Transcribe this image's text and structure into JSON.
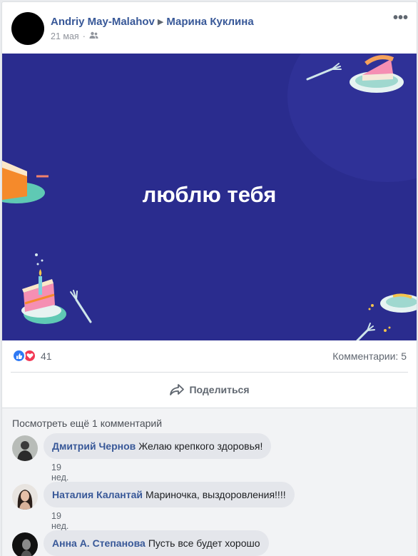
{
  "post": {
    "author": "Andriy May-Malahov",
    "arrow": "▶",
    "recipient": "Марина Куклина",
    "date": "21 мая",
    "separator": "·",
    "audience_icon": "friends-icon",
    "menu_label": "•••",
    "banner_text": "люблю тебя",
    "banner_color": "#2a2c8e"
  },
  "stats": {
    "reactions_count": "41",
    "comments_label": "Комментарии: 5"
  },
  "actions": {
    "share_label": "Поделиться"
  },
  "comments": {
    "view_more": "Посмотреть ещё 1 комментарий",
    "items": [
      {
        "name": "Дмитрий Чернов",
        "text": "Желаю крепкого здоровья!",
        "time": "19 нед."
      },
      {
        "name": "Наталия Калантай",
        "text": "Мариночка, выздоровления!!!!",
        "time": "19 нед."
      },
      {
        "name": "Анна А. Степанова",
        "text": "Пусть все будет хорошо",
        "time": ""
      }
    ]
  },
  "colors": {
    "link": "#385898",
    "like": "#2e79f4",
    "love": "#f23854"
  }
}
